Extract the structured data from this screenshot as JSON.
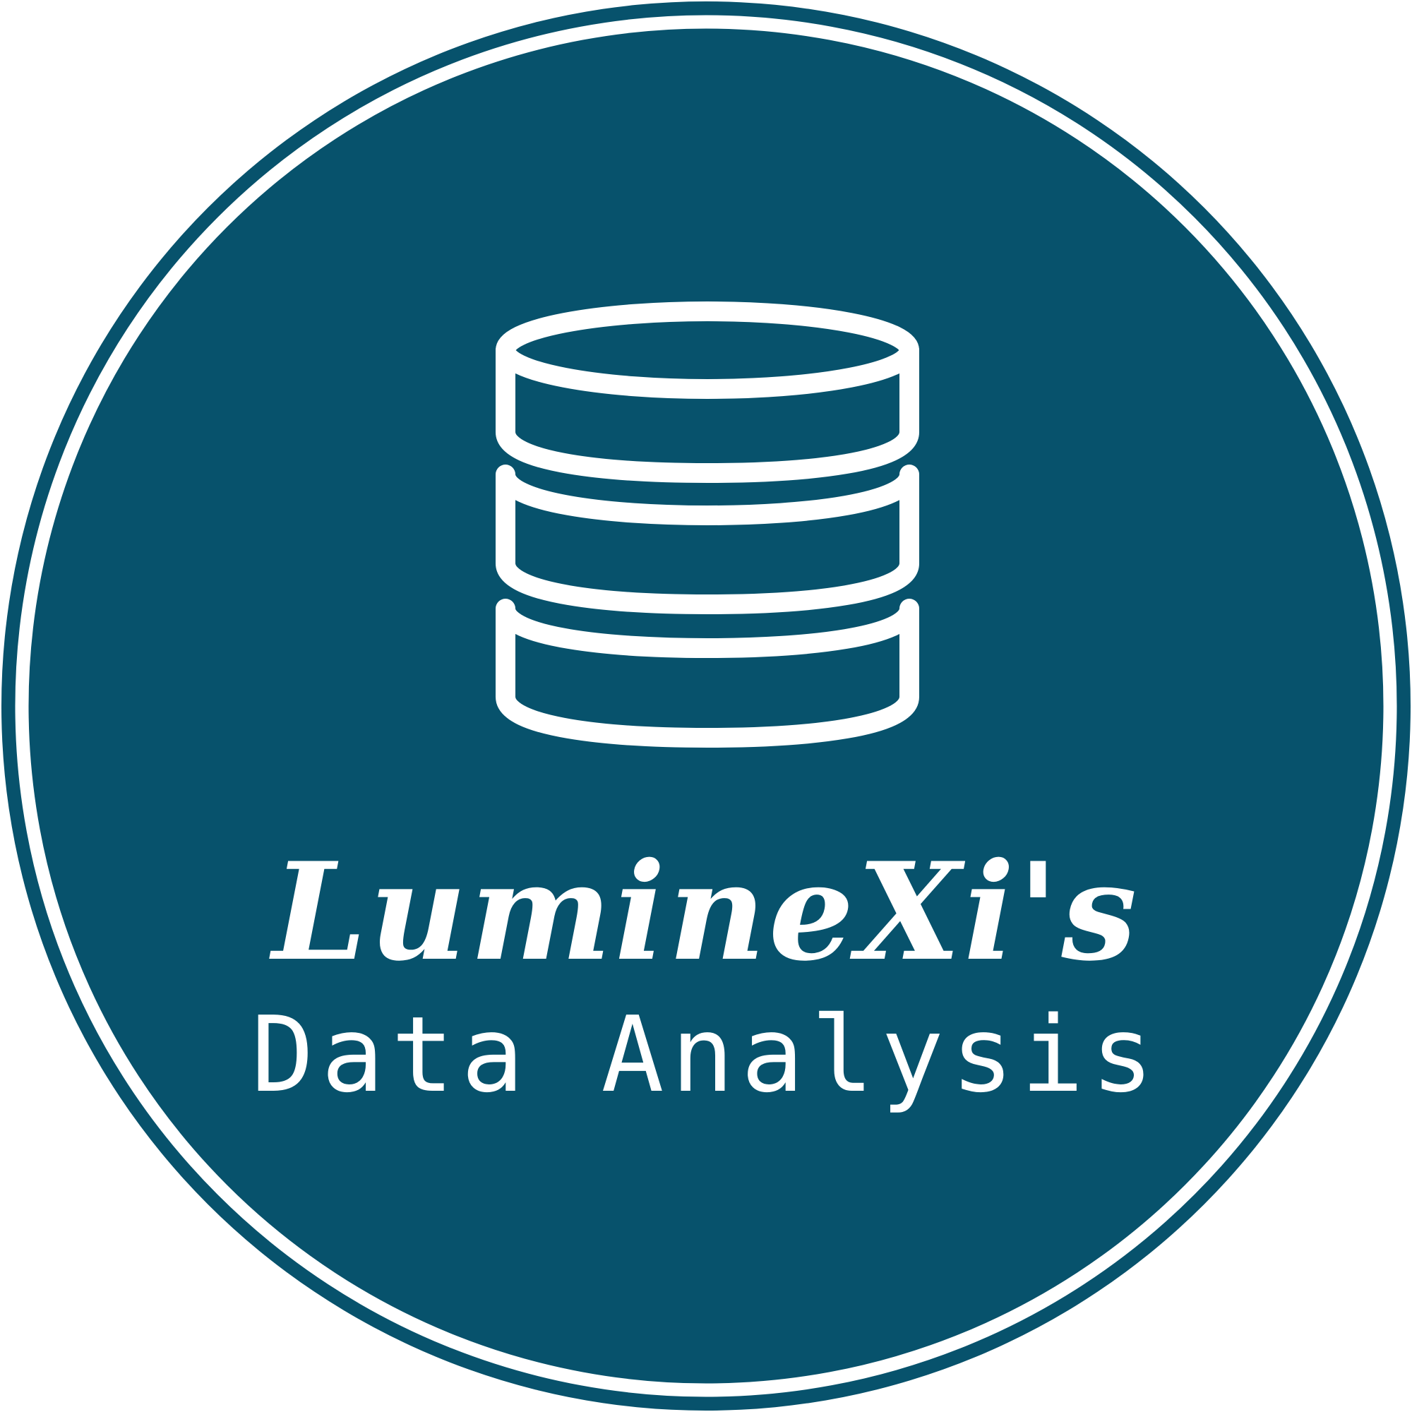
{
  "logo": {
    "brand_name": "LumineXi's",
    "tagline": "Data Analysis",
    "icon": "database-icon"
  },
  "colors": {
    "badge_fill": "#07526C",
    "line": "#FFFFFF",
    "background": "#FFFFFF"
  }
}
